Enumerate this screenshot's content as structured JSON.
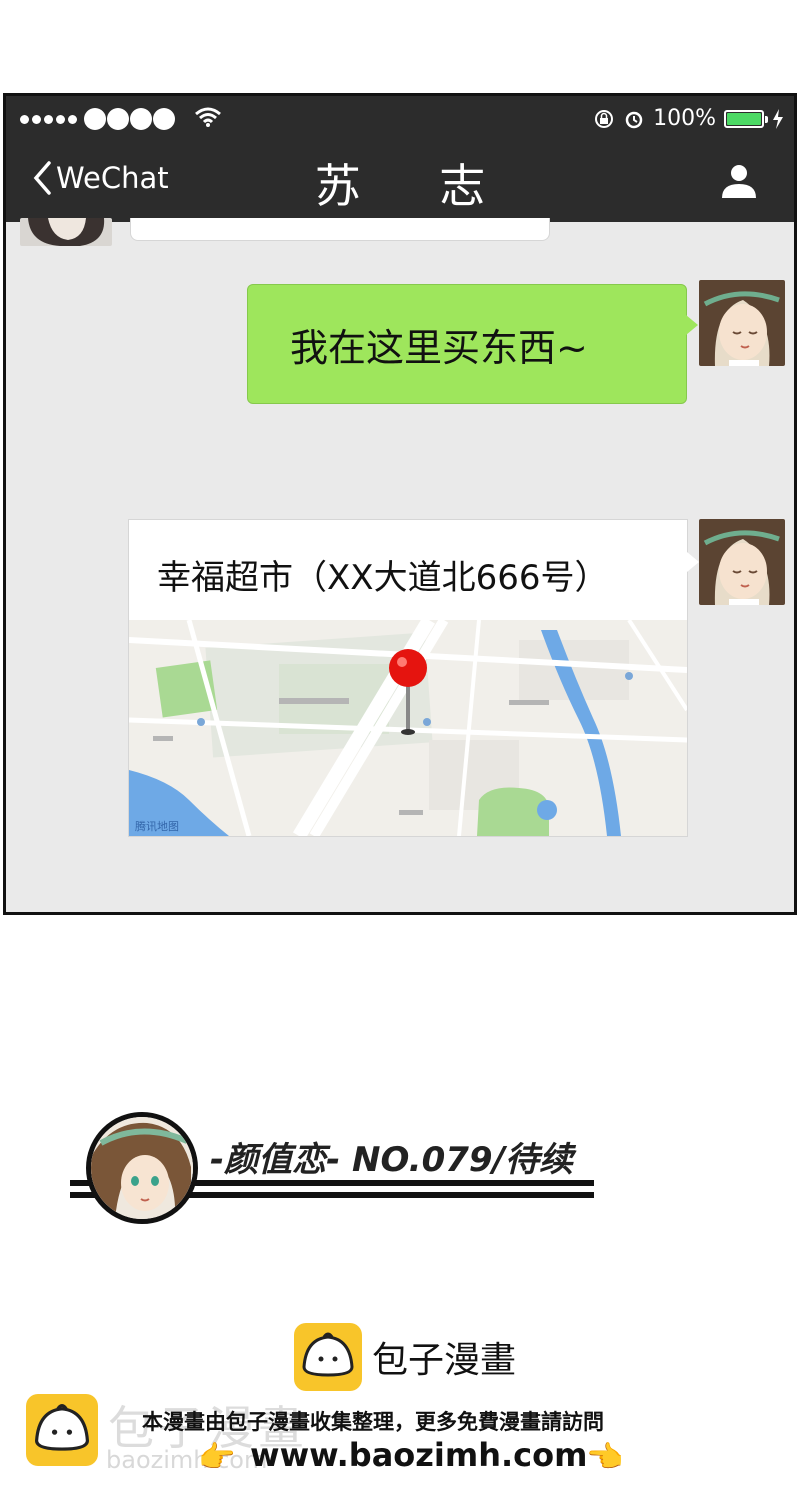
{
  "status_bar": {
    "battery_percent": "100%",
    "battery_level": 1.0,
    "battery_color": "#4cd964"
  },
  "nav": {
    "back_label": "WeChat",
    "title": "苏 志",
    "profile_icon": "person-icon"
  },
  "messages": [
    {
      "type": "text",
      "text": "我在这里买东西~",
      "bubble_color": "#9ee65c"
    },
    {
      "type": "location",
      "place": "幸福超市（XX大道北666号）",
      "map_logo": "腾讯地图"
    }
  ],
  "footer": {
    "series_title": "-颜值恋- NO.079/待续",
    "brand_name": "包子漫畫",
    "ghost_brand": "包子漫畫",
    "watermark_note": "本漫畫由包子漫畫收集整理，更多免費漫畫請訪問",
    "watermark_url": "www.baozimh.com",
    "ghost_url": "baozimh.com"
  }
}
